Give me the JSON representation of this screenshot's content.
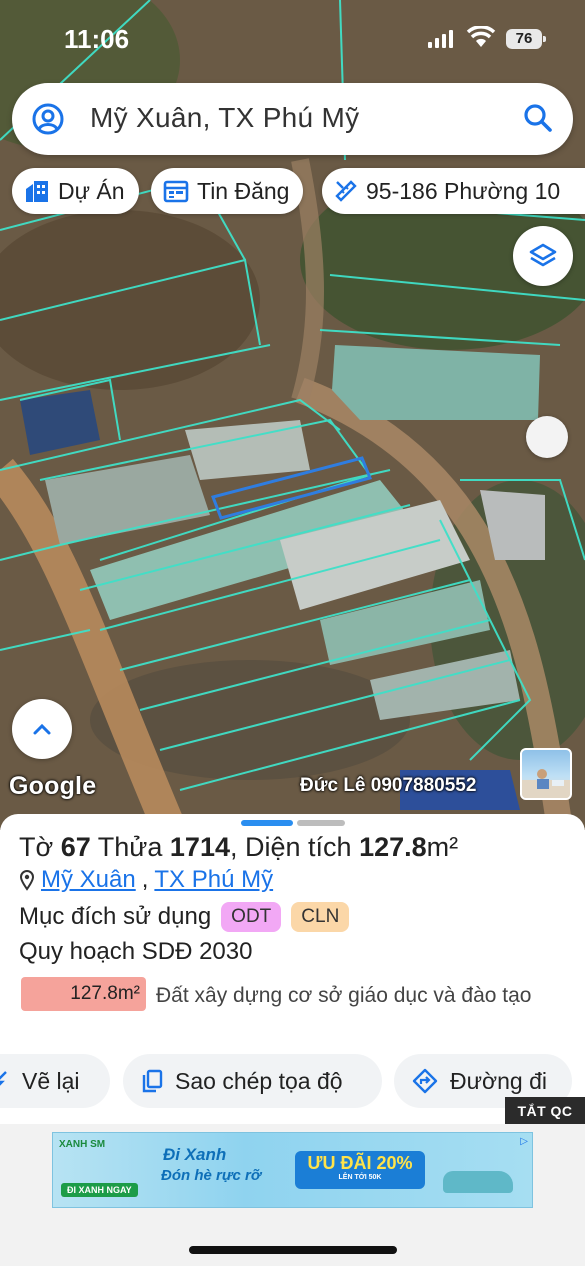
{
  "status_bar": {
    "time": "11:06",
    "battery": "76"
  },
  "search": {
    "query": "Mỹ Xuân, TX Phú Mỹ"
  },
  "chips": [
    {
      "label": "Dự Án",
      "icon": "building-icon"
    },
    {
      "label": "Tin Đăng",
      "icon": "calendar-icon"
    },
    {
      "label": "95-186 Phường 10",
      "icon": "ruler-icon"
    }
  ],
  "map": {
    "attribution": "Google",
    "watermark": "Đức Lê 0907880552"
  },
  "parcel": {
    "sheet_label": "Tờ",
    "sheet_no": "67",
    "plot_label": "Thửa",
    "plot_no": "1714",
    "area_label": "Diện tích",
    "area_value": "127.8",
    "area_unit": "m²",
    "ward": "Mỹ Xuân",
    "town": "TX Phú Mỹ",
    "purpose_label": "Mục đích sử dụng",
    "purpose_tags": [
      {
        "code": "ODT",
        "color": "#f2a8f5"
      },
      {
        "code": "CLN",
        "color": "#fbd7a8"
      }
    ],
    "plan_label": "Quy hoạch SDĐ 2030",
    "plan_area": "127.8m²",
    "plan_color": "#f5a39b",
    "plan_desc": "Đất xây dựng cơ sở giáo dục và đào tạo"
  },
  "actions": [
    {
      "label": "Vẽ lại",
      "icon": "redraw-icon"
    },
    {
      "label": "Sao chép tọa độ",
      "icon": "copy-icon"
    },
    {
      "label": "Đường đi",
      "icon": "directions-icon"
    }
  ],
  "ad": {
    "close_label": "TẮT QC",
    "brand": "XANH SM",
    "cta": "ĐI XANH NGAY",
    "headline1": "Đi Xanh",
    "headline2": "Đón hè rực rỡ",
    "offer": "ƯU ĐÃI 20%",
    "offer_sub": "LÊN TỚI 50K"
  },
  "colors": {
    "accent": "#1a73e8",
    "parcel_line": "#3fe0c8",
    "selected_parcel": "#2f7de0"
  }
}
